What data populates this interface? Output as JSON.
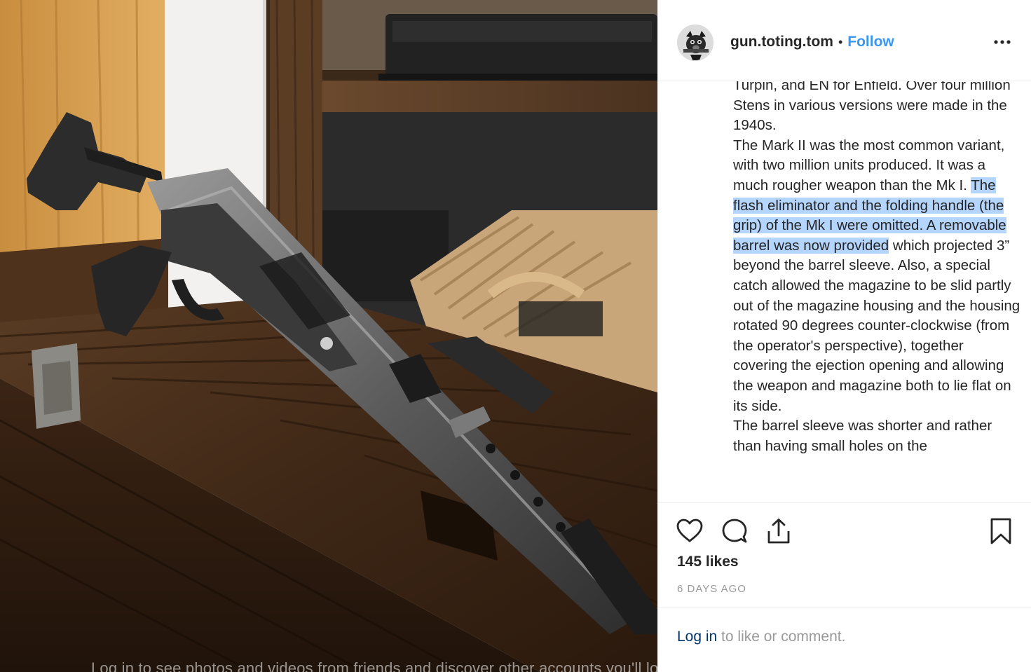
{
  "post": {
    "username": "gun.toting.tom",
    "separator": "•",
    "follow_label": "Follow",
    "more_label": "more-options-icon"
  },
  "caption": {
    "p1": "Turpin, and EN for Enfield. Over four million Stens in various versions were made in the 1940s.",
    "p2_pre": "The Mark II was the most common variant, with two million units produced. It was a much rougher weapon than the Mk I. ",
    "p2_highlight": "The flash eliminator and the folding handle (the grip) of the Mk I were omitted. A removable barrel was now provided",
    "p2_post": " which projected 3” beyond the barrel sleeve. Also, a special catch allowed the magazine to be slid partly out of the magazine housing and the housing rotated 90 degrees counter-clockwise (from the operator's perspective), together covering the ejection opening and allowing the weapon and magazine both to lie flat on its side.",
    "p3": "The barrel sleeve was shorter and rather than having small holes on the"
  },
  "actions": {
    "like_icon": "heart-icon",
    "comment_icon": "comment-icon",
    "share_icon": "share-icon",
    "save_icon": "bookmark-icon"
  },
  "likes_text": "145 likes",
  "time_text": "6 DAYS AGO",
  "login": {
    "link_text": "Log in",
    "rest_text": " to like or comment."
  },
  "photo_overlay": {
    "text": "Log in to see photos and videos from friends and discover other accounts you'll love."
  },
  "colors": {
    "link_blue": "#3897f0",
    "login_blue": "#003569",
    "selection": "#b4d5fe",
    "text": "#262626",
    "muted": "#999999"
  }
}
